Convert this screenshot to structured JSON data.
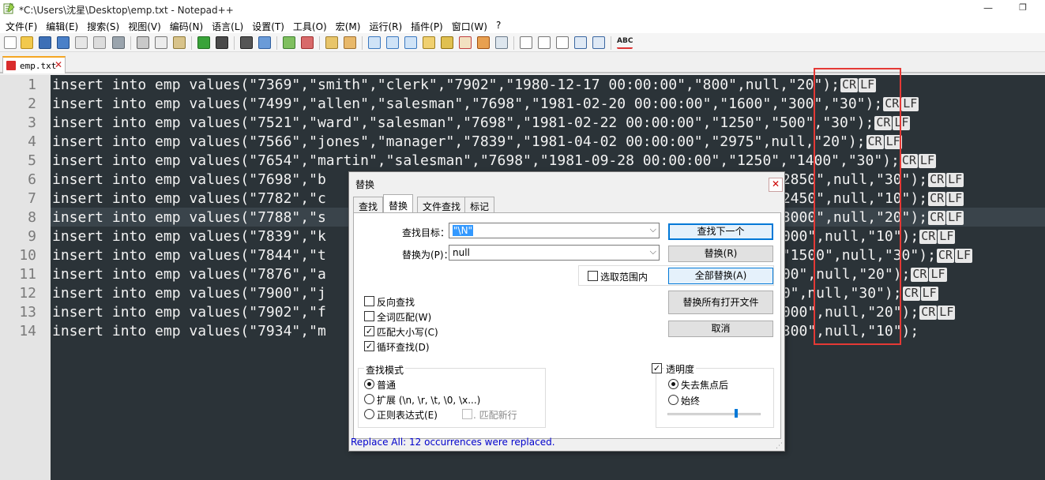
{
  "window": {
    "title": "*C:\\Users\\沈星\\Desktop\\emp.txt - Notepad++",
    "min_glyph": "—",
    "max_glyph": "❐"
  },
  "menu": [
    "文件(F)",
    "编辑(E)",
    "搜索(S)",
    "视图(V)",
    "编码(N)",
    "语言(L)",
    "设置(T)",
    "工具(O)",
    "宏(M)",
    "运行(R)",
    "插件(P)",
    "窗口(W)",
    "?"
  ],
  "toolbar": {
    "spellcheck_label": "ABC"
  },
  "tab": {
    "label": "emp.txt",
    "close_glyph": "✕"
  },
  "editor": {
    "line_numbers": [
      "1",
      "2",
      "3",
      "4",
      "5",
      "6",
      "7",
      "8",
      "9",
      "10",
      "11",
      "12",
      "13",
      "14"
    ],
    "lines": [
      "insert into emp values(\"7369\",\"smith\",\"clerk\",\"7902\",\"1980-12-17 00:00:00\",\"800\",null,\"20\");",
      "insert into emp values(\"7499\",\"allen\",\"salesman\",\"7698\",\"1981-02-20 00:00:00\",\"1600\",\"300\",\"30\");",
      "insert into emp values(\"7521\",\"ward\",\"salesman\",\"7698\",\"1981-02-22 00:00:00\",\"1250\",\"500\",\"30\");",
      "insert into emp values(\"7566\",\"jones\",\"manager\",\"7839\",\"1981-04-02 00:00:00\",\"2975\",null,\"20\");",
      "insert into emp values(\"7654\",\"martin\",\"salesman\",\"7698\",\"1981-09-28 00:00:00\",\"1250\",\"1400\",\"30\");",
      "insert into emp values(\"7698\",\"b",
      "insert into emp values(\"7782\",\"c",
      "insert into emp values(\"7788\",\"s",
      "insert into emp values(\"7839\",\"k",
      "insert into emp values(\"7844\",\"t",
      "insert into emp values(\"7876\",\"a",
      "insert into emp values(\"7900\",\"j",
      "insert into emp values(\"7902\",\"f",
      "insert into emp values(\"7934\",\"m"
    ],
    "line_tails": [
      "",
      "",
      "",
      "",
      "",
      "\"2850\",null,\"30\");",
      "\"2450\",null,\"10\");",
      "\"3000\",null,\"20\");",
      "5000\",null,\"10\");",
      ",\"1500\",null,\"30\");",
      "100\",null,\"20\");",
      "50\",null,\"30\");",
      "3000\",null,\"20\");",
      "1300\",null,\"10\");"
    ],
    "eol_cr": "CR",
    "eol_lf": "LF"
  },
  "dialog": {
    "title": "替换",
    "close_glyph": "✕",
    "tabs": [
      "查找",
      "替换",
      "文件查找",
      "标记"
    ],
    "find_label": "查找目标：",
    "find_value": "\"\\N\"",
    "replace_label": "替换为(P)：",
    "replace_value": "null",
    "combo_arrow": "⌵",
    "in_selection_label": "选取范围内",
    "buttons": {
      "find_next": "查找下一个",
      "replace": "替换(R)",
      "replace_all": "全部替换(A)",
      "replace_all_open": "替换所有打开文件",
      "cancel": "取消"
    },
    "options": [
      {
        "label": "反向查找",
        "checked": false
      },
      {
        "label": "全词匹配(W)",
        "checked": false
      },
      {
        "label": "匹配大小写(C)",
        "checked": true
      },
      {
        "label": "循环查找(D)",
        "checked": true
      }
    ],
    "check_glyph": "✓",
    "search_mode": {
      "title": "查找模式",
      "normal": "普通",
      "extended": "扩展 (\\n, \\r, \\t, \\0, \\x...)",
      "regex": "正则表达式(E)",
      "dot_newline": ". 匹配新行"
    },
    "transparency": {
      "title": "透明度",
      "on_lose_focus": "失去焦点后",
      "always": "始终",
      "level": 0.74
    },
    "status": "Replace All: 12 occurrences were replaced.",
    "grip_glyph": "⋰"
  },
  "colors": {
    "editor_bg": "#2b3338",
    "highlight_box": "#e53935",
    "status_text": "#0000cc"
  }
}
